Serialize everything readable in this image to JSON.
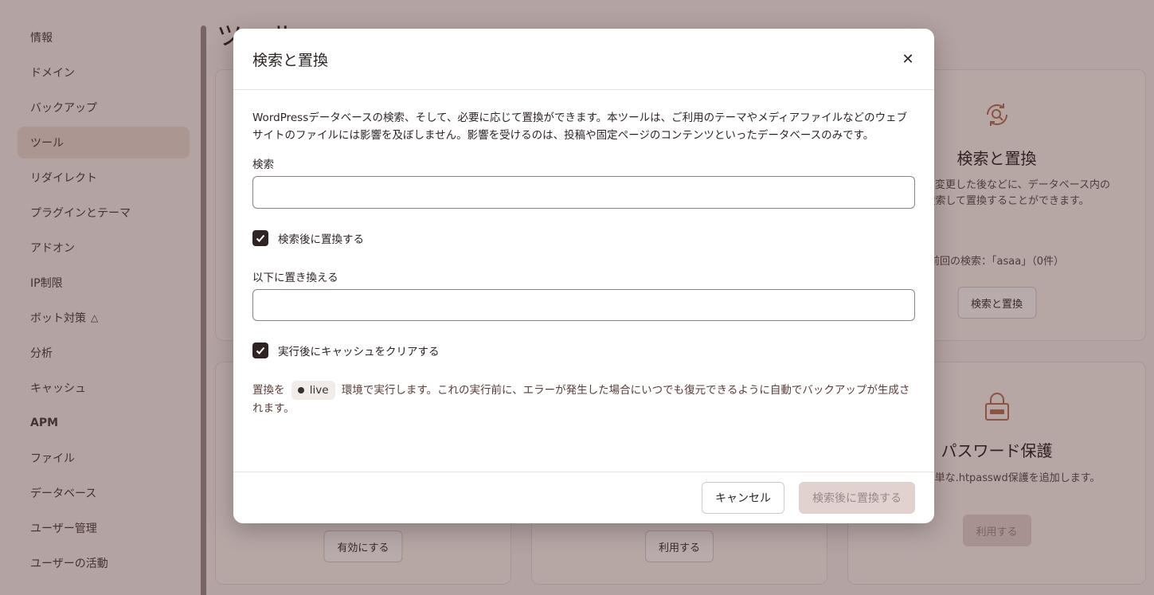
{
  "sidebar": {
    "items": [
      {
        "label": "情報",
        "active": false
      },
      {
        "label": "ドメイン",
        "active": false
      },
      {
        "label": "バックアップ",
        "active": false
      },
      {
        "label": "ツール",
        "active": true
      },
      {
        "label": "リダイレクト",
        "active": false
      },
      {
        "label": "プラグインとテーマ",
        "active": false
      },
      {
        "label": "アドオン",
        "active": false
      },
      {
        "label": "IP制限",
        "active": false
      },
      {
        "label": "ボット対策",
        "active": false
      },
      {
        "label": "分析",
        "active": false
      },
      {
        "label": "キャッシュ",
        "active": false
      },
      {
        "label": "APM",
        "active": false
      },
      {
        "label": "ファイル",
        "active": false
      },
      {
        "label": "データベース",
        "active": false
      },
      {
        "label": "ユーザー管理",
        "active": false
      },
      {
        "label": "ユーザーの活動",
        "active": false
      }
    ],
    "flask_icon": "flask-icon"
  },
  "main": {
    "page_title": "ツール",
    "cards": {
      "search_replace": {
        "title": "検索と置換",
        "desc": "ドメインを変更した後などに、データベース内の値を検索して置換することができます。",
        "meta": "前回の検索：「asaa」（0件）",
        "button": "検索と置換",
        "icon": "search-refresh-icon"
      },
      "password": {
        "title": "パスワード保護",
        "desc": "環境に簡単な.htpasswd保護を追加します。",
        "button": "利用する",
        "icon": "lock-icon"
      },
      "bottom_left_button": "有効にする",
      "bottom_mid_button": "利用する"
    }
  },
  "modal": {
    "title": "検索と置換",
    "description": "WordPressデータベースの検索、そして、必要に応じて置換ができます。本ツールは、ご利用のテーマやメディアファイルなどのウェブサイトのファイルには影響を及ぼしません。影響を受けるのは、投稿や固定ページのコンテンツといったデータベースのみです。",
    "search_label": "検索",
    "search_value": "",
    "replace_checkbox_label": "検索後に置換する",
    "replace_checked": true,
    "replace_label": "以下に置き換える",
    "replace_value": "",
    "cache_checkbox_label": "実行後にキャッシュをクリアする",
    "cache_checked": true,
    "note_prefix": "置換を",
    "env_name": "live",
    "note_suffix": "環境で実行します。これの実行前に、エラーが発生した場合にいつでも復元できるように自動でバックアップが生成されます。",
    "cancel_label": "キャンセル",
    "submit_label": "検索後に置換する"
  },
  "colors": {
    "accent": "#b7705a",
    "dark": "#2e2424",
    "disabled_bg": "#e1d2cf"
  }
}
